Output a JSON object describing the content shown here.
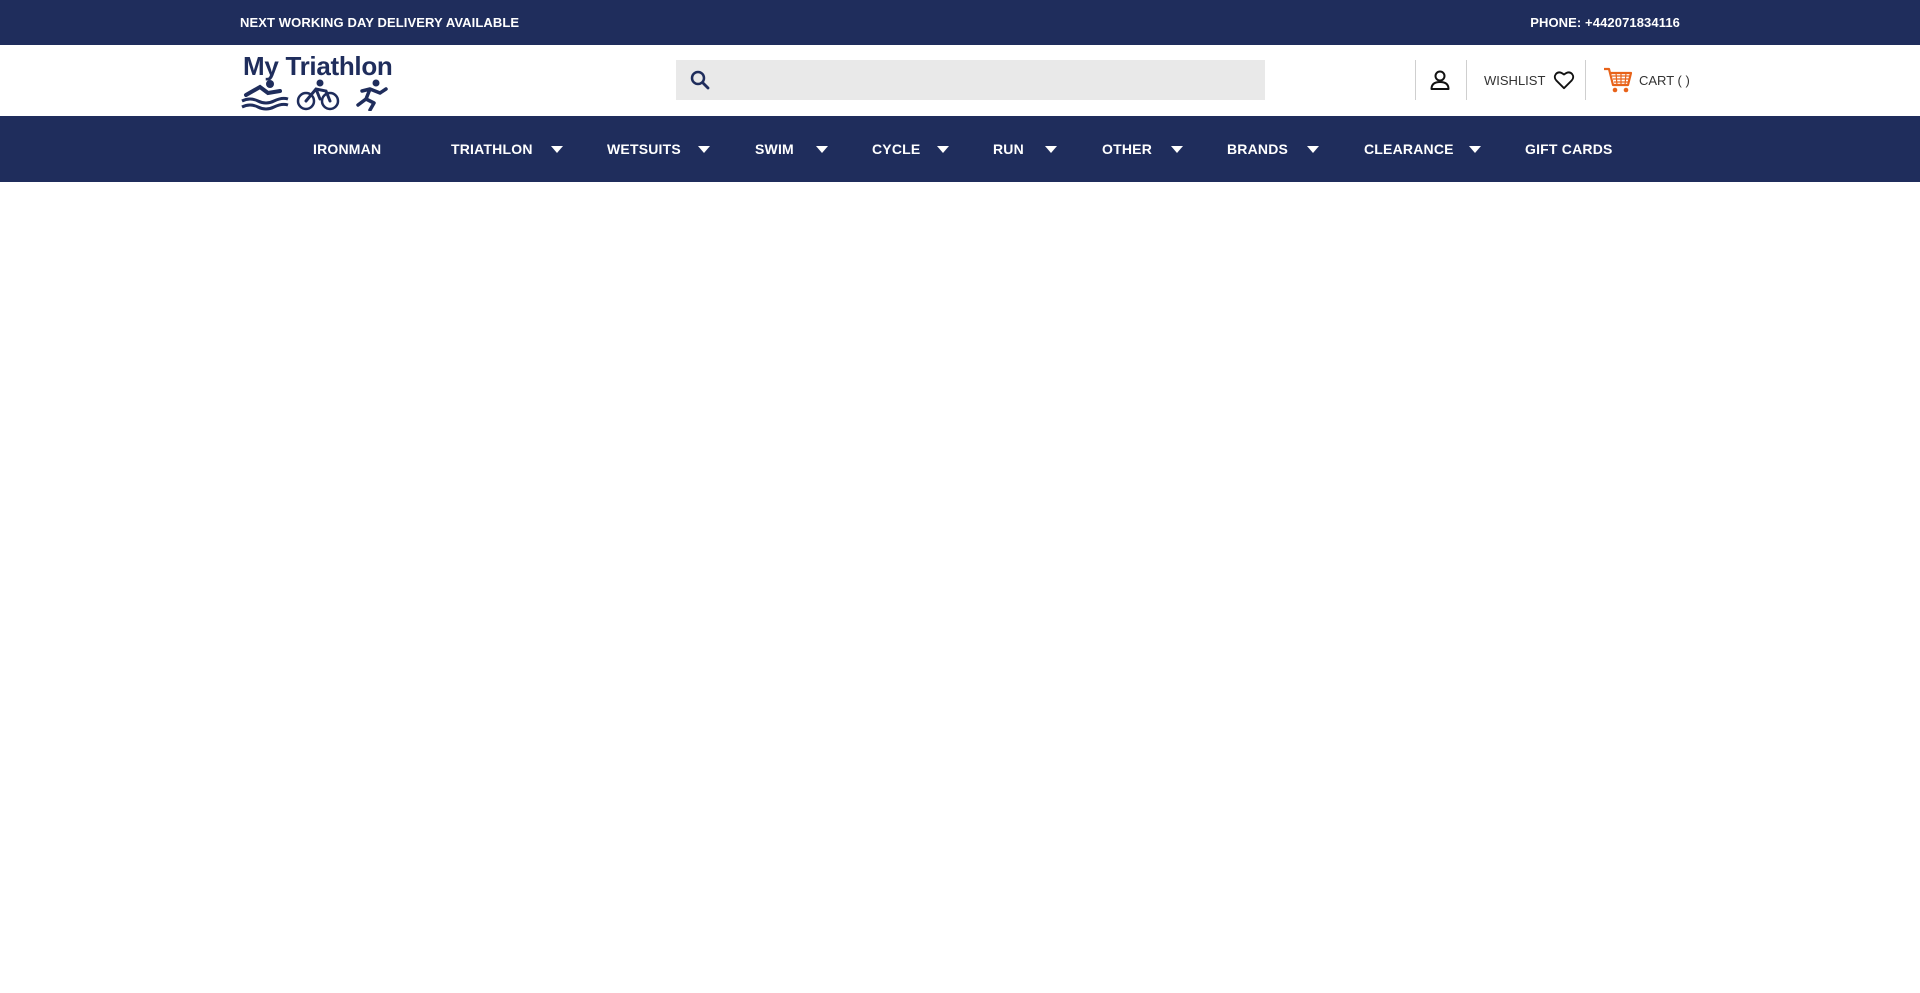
{
  "topbar": {
    "delivery_text": "NEXT WORKING DAY DELIVERY AVAILABLE",
    "phone_text": "PHONE: +442071834116"
  },
  "header": {
    "logo_text": "My Triathlon",
    "search": {
      "placeholder": "",
      "value": ""
    },
    "wishlist_label": "WISHLIST",
    "cart_label": "CART ( )"
  },
  "nav": {
    "items": [
      {
        "label": "IRONMAN",
        "has_dropdown": false
      },
      {
        "label": "TRIATHLON",
        "has_dropdown": true
      },
      {
        "label": "WETSUITS",
        "has_dropdown": true
      },
      {
        "label": "SWIM",
        "has_dropdown": true
      },
      {
        "label": "CYCLE",
        "has_dropdown": true
      },
      {
        "label": "RUN",
        "has_dropdown": true
      },
      {
        "label": "OTHER",
        "has_dropdown": true
      },
      {
        "label": "BRANDS",
        "has_dropdown": true
      },
      {
        "label": "CLEARANCE",
        "has_dropdown": true
      },
      {
        "label": "GIFT CARDS",
        "has_dropdown": false
      }
    ]
  },
  "colors": {
    "brand_navy": "#1f2d5c",
    "cart_orange": "#e8631a",
    "search_bg": "#e9e9e9"
  },
  "icons": [
    "search-icon",
    "account-icon",
    "heart-icon",
    "cart-icon",
    "chevron-down-icon"
  ]
}
